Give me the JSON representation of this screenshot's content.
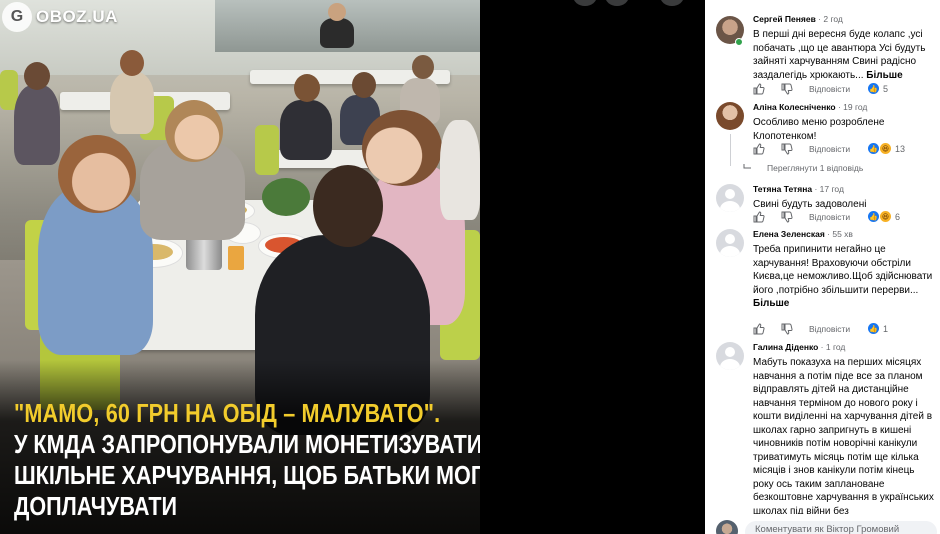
{
  "post": {
    "brand": "OBOZ.UA",
    "headline_quote": "\"МАМО, 60 ГРН НА ОБІД – МАЛУВАТО\".",
    "headline_lines": [
      "У КМДА ЗАПРОПОНУВАЛИ МОНЕТИЗУВАТИ",
      "ШКІЛЬНЕ ХАРЧУВАННЯ, ЩОБ БАТЬКИ МОГЛИ",
      "ДОПЛАЧУВАТИ"
    ],
    "colors": {
      "quote": "#f2cc2c",
      "text": "#ffffff"
    }
  },
  "comments": [
    {
      "name": "Сергей Пеняев",
      "time": "· 2 год",
      "text": "В перші дні вересня буде колапс ,усі побачать ,що це авантюра Усі будуть зайняті харчуванням Свині радісно заздалегідь хрюкають...",
      "more": "Більше",
      "reply": "Відповісти",
      "reactions": [
        "like"
      ],
      "count": "5"
    },
    {
      "name": "Аліна Колесніченко",
      "time": "· 19 год",
      "text": "Особливо меню розроблене Клопотенком!",
      "reply": "Відповісти",
      "reactions": [
        "like",
        "haha"
      ],
      "count": "13",
      "see_replies": "Переглянути 1 відповідь"
    },
    {
      "name": "Тетяна Тетяна",
      "time": "· 17 год",
      "text": "Свині будуть задоволені",
      "reply": "Відповісти",
      "reactions": [
        "like",
        "haha"
      ],
      "count": "6"
    },
    {
      "name": "Елена Зеленская",
      "time": "· 55 хв",
      "text": "Треба припинити негайно це харчування! Враховуючи обстріли Києва,це неможливо.Щоб здійснювати його ,потрібно збільшити перерви...",
      "more": "Більше",
      "reply": "Відповісти",
      "reactions": [
        "like"
      ],
      "count": "1"
    },
    {
      "name": "Галина Діденко",
      "time": "· 1 год",
      "text": "Мабуть показуха на перших місяцях навчання а потім піде все за планом відправлять дітей на дистанційне навчання терміном до нового року і кошти виділенні на харчування дітей в школах гарно запригнуть в кишені чиновників потім новорічні канікули триватимуть місяць потім ще кілька місяців і знов канікули потім кінець року ось таким заплановане безкоштовне харчування в українських школах під війни без"
    }
  ],
  "composer": {
    "placeholder": "Коментувати як Віктор Громовий"
  }
}
